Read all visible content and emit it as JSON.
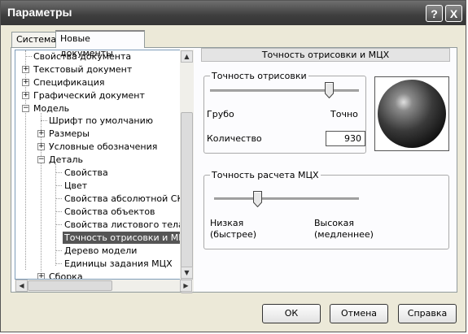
{
  "window": {
    "title": "Параметры",
    "help_glyph": "?",
    "close_glyph": "X"
  },
  "tabs": [
    {
      "label": "Система"
    },
    {
      "label": "Новые документы"
    }
  ],
  "tree": {
    "items": [
      {
        "label": "Свойства документа"
      },
      {
        "label": "Текстовый документ"
      },
      {
        "label": "Спецификация"
      },
      {
        "label": "Графический документ"
      },
      {
        "label": "Модель"
      },
      {
        "label": "Шрифт по умолчанию"
      },
      {
        "label": "Размеры"
      },
      {
        "label": "Условные обозначения"
      },
      {
        "label": "Деталь"
      },
      {
        "label": "Свойства"
      },
      {
        "label": "Цвет"
      },
      {
        "label": "Свойства абсолютной СК"
      },
      {
        "label": "Свойства объектов"
      },
      {
        "label": "Свойства листового тела"
      },
      {
        "label": "Точность отрисовки и МЦХ"
      },
      {
        "label": "Дерево модели"
      },
      {
        "label": "Единицы задания МЦХ"
      },
      {
        "label": "Сборка"
      }
    ],
    "plus": "+",
    "minus": "−"
  },
  "content": {
    "header": "Точность отрисовки и МЦХ",
    "render_group": {
      "title": "Точность отрисовки",
      "min_label": "Грубо",
      "max_label": "Точно",
      "slider_fraction": 0.8,
      "count_label": "Количество",
      "count_value": "930"
    },
    "mcx_group": {
      "title": "Точность расчета МЦХ",
      "min_label_1": "Низкая",
      "min_label_2": "(быстрее)",
      "max_label_1": "Высокая",
      "max_label_2": "(медленнее)",
      "slider_fraction": 0.3
    }
  },
  "buttons": {
    "ok": "ОК",
    "cancel": "Отмена",
    "help": "Справка"
  }
}
